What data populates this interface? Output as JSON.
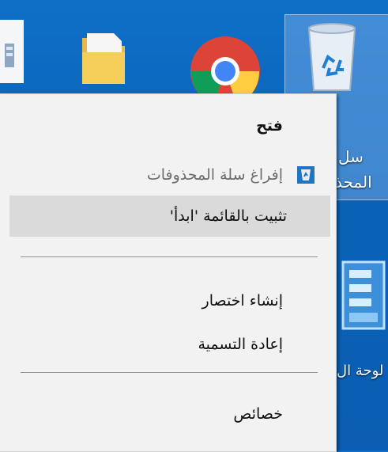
{
  "desktop": {
    "icons": [
      {
        "name": "document-icon"
      },
      {
        "name": "folder-icon"
      },
      {
        "name": "chrome-icon"
      },
      {
        "name": "recycle-bin-icon",
        "label_line1": "سل",
        "label_line2": "المحذ"
      },
      {
        "name": "control-panel-icon",
        "label": "لوحة ال"
      }
    ]
  },
  "context_menu": {
    "items": [
      {
        "key": "open",
        "label": "فتح",
        "bold": true
      },
      {
        "key": "empty_recycle_bin",
        "label": "إفراغ سلة المحذوفات",
        "disabled": true,
        "icon": "recycle-bin-icon"
      },
      {
        "key": "pin_to_start",
        "label": "تثبيت بالقائمة 'ابدأ'",
        "hover": true
      },
      {
        "key": "create_shortcut",
        "label": "إنشاء اختصار"
      },
      {
        "key": "rename",
        "label": "إعادة التسمية"
      },
      {
        "key": "properties",
        "label": "خصائص"
      }
    ]
  },
  "colors": {
    "desktop_bg": "#0a63b8",
    "menu_bg": "#f2f2f2",
    "hover_bg": "#dadada",
    "disabled_text": "#6d6d6d"
  }
}
